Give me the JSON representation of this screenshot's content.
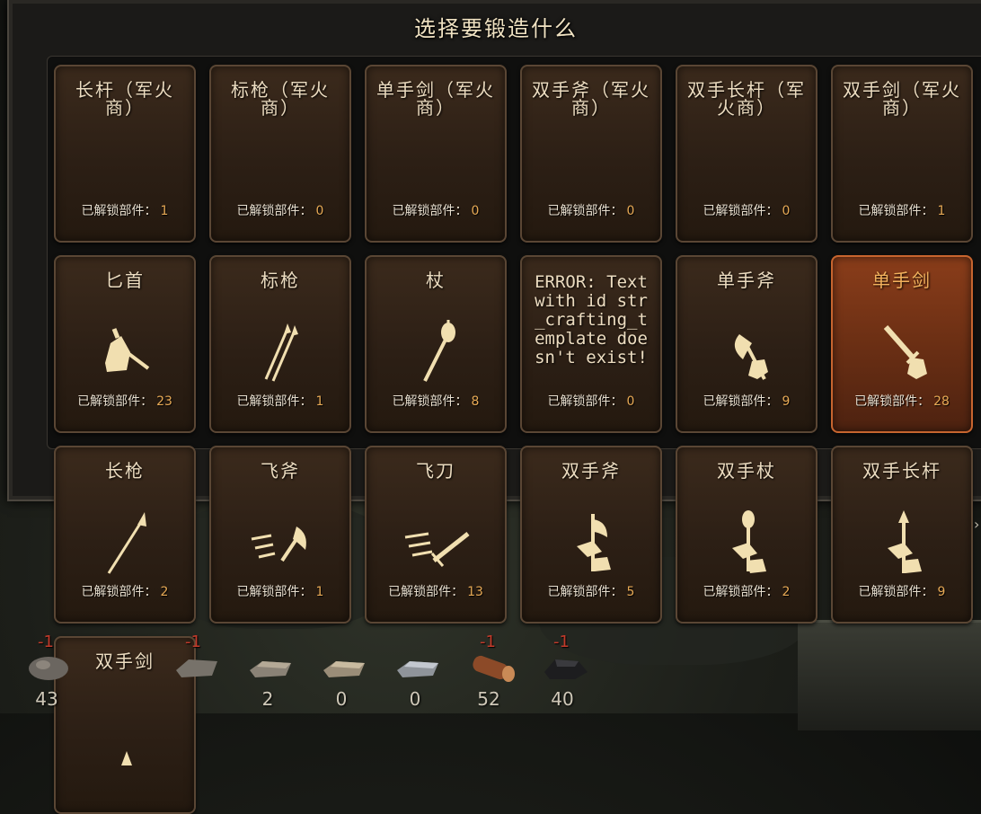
{
  "dialog": {
    "title": "选择要锻造什么"
  },
  "count_label": "已解锁部件：",
  "cards": [
    {
      "title": "长杆（军火商）",
      "count": "1",
      "icon": "none"
    },
    {
      "title": "标枪（军火商）",
      "count": "0",
      "icon": "none"
    },
    {
      "title": "单手剑（军火商）",
      "count": "0",
      "icon": "none"
    },
    {
      "title": "双手斧（军火商）",
      "count": "0",
      "icon": "none"
    },
    {
      "title": "双手长杆（军火商）",
      "count": "0",
      "icon": "none"
    },
    {
      "title": "双手剑（军火商）",
      "count": "1",
      "icon": "none"
    },
    {
      "title": "匕首",
      "count": "23",
      "icon": "dagger-icon"
    },
    {
      "title": "标枪",
      "count": "1",
      "icon": "javelin-icon"
    },
    {
      "title": "杖",
      "count": "8",
      "icon": "mace-icon"
    },
    {
      "title": "ERROR: Text with id str_crafting_template doesn't exist!",
      "count": "0",
      "icon": "none",
      "error": true
    },
    {
      "title": "单手斧",
      "count": "9",
      "icon": "one-handed-axe-icon"
    },
    {
      "title": "单手剑",
      "count": "28",
      "icon": "one-handed-sword-icon",
      "selected": true
    },
    {
      "title": "长枪",
      "count": "2",
      "icon": "spear-icon"
    },
    {
      "title": "飞斧",
      "count": "1",
      "icon": "throwing-axe-icon"
    },
    {
      "title": "飞刀",
      "count": "13",
      "icon": "throwing-knife-icon"
    },
    {
      "title": "双手斧",
      "count": "5",
      "icon": "two-handed-axe-icon"
    },
    {
      "title": "双手杖",
      "count": "2",
      "icon": "two-handed-mace-icon"
    },
    {
      "title": "双手长杆",
      "count": "9",
      "icon": "two-handed-polearm-icon"
    },
    {
      "title": "双手剑",
      "count": "",
      "icon": "two-handed-sword-icon",
      "partial": true
    }
  ],
  "resources": [
    {
      "name": "iron-ore-icon",
      "amount": "43",
      "delta": "-1"
    },
    {
      "name": "crude-iron-icon",
      "amount": "",
      "delta": "-1"
    },
    {
      "name": "wrought-iron-icon",
      "amount": "2",
      "delta": ""
    },
    {
      "name": "iron-ingot-icon",
      "amount": "0",
      "delta": ""
    },
    {
      "name": "steel-ingot-icon",
      "amount": "0",
      "delta": ""
    },
    {
      "name": "hardwood-icon",
      "amount": "52",
      "delta": "-1"
    },
    {
      "name": "charcoal-icon",
      "amount": "40",
      "delta": "-1"
    }
  ],
  "colors": {
    "accent": "#e6a955",
    "selected": "#c7652f",
    "delta": "#c23a2a"
  }
}
